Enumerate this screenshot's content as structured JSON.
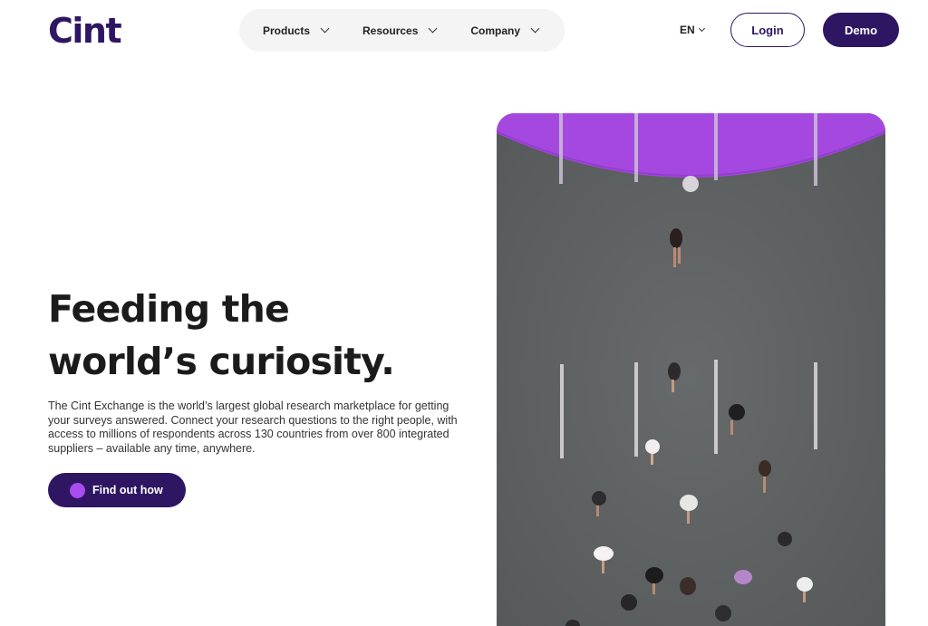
{
  "brand": {
    "logo_text": "Cint"
  },
  "nav": {
    "items": [
      {
        "label": "Products"
      },
      {
        "label": "Resources"
      },
      {
        "label": "Company"
      }
    ]
  },
  "header": {
    "language": "EN",
    "login_label": "Login",
    "demo_label": "Demo"
  },
  "hero": {
    "headline_line1": "Feeding the",
    "headline_line2": "world’s curiosity.",
    "description": "The Cint Exchange is the world’s largest global research marketplace for getting your surveys answered. Connect your research questions to the right people, with access to millions of respondents across 130 countries from over 800 integrated suppliers – available any time, anywhere.",
    "cta_label": "Find out how",
    "image_subject": "aerial view of runners on a road with purple finish line"
  },
  "colors": {
    "brand_dark": "#2e1663",
    "accent_purple": "#a94cf0",
    "road_grey": "#5e6061"
  }
}
